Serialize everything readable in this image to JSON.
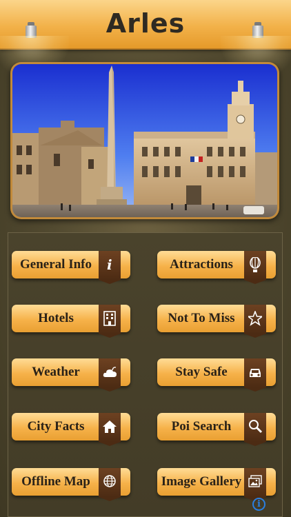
{
  "header": {
    "title": "Arles"
  },
  "menu": [
    {
      "label": "General Info",
      "icon": "info-icon"
    },
    {
      "label": "Attractions",
      "icon": "balloon-icon"
    },
    {
      "label": "Hotels",
      "icon": "building-icon"
    },
    {
      "label": "Not To Miss",
      "icon": "star-icon"
    },
    {
      "label": "Weather",
      "icon": "cloud-icon"
    },
    {
      "label": "Stay Safe",
      "icon": "car-icon"
    },
    {
      "label": "City Facts",
      "icon": "home-icon"
    },
    {
      "label": "Poi Search",
      "icon": "search-icon"
    },
    {
      "label": "Offline Map",
      "icon": "globe-icon"
    },
    {
      "label": "Image Gallery",
      "icon": "gallery-icon"
    }
  ],
  "colors": {
    "header": "#f2b149",
    "button": "#f6b24a",
    "icon_tag": "#5b3519",
    "background": "#524a30",
    "info": "#2a7fe0"
  }
}
